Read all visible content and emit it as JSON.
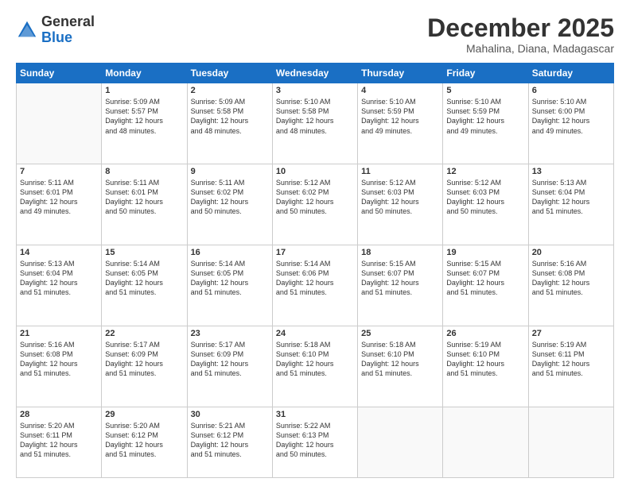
{
  "logo": {
    "general": "General",
    "blue": "Blue"
  },
  "header": {
    "month": "December 2025",
    "location": "Mahalina, Diana, Madagascar"
  },
  "weekdays": [
    "Sunday",
    "Monday",
    "Tuesday",
    "Wednesday",
    "Thursday",
    "Friday",
    "Saturday"
  ],
  "weeks": [
    [
      {
        "day": "",
        "info": ""
      },
      {
        "day": "1",
        "info": "Sunrise: 5:09 AM\nSunset: 5:57 PM\nDaylight: 12 hours\nand 48 minutes."
      },
      {
        "day": "2",
        "info": "Sunrise: 5:09 AM\nSunset: 5:58 PM\nDaylight: 12 hours\nand 48 minutes."
      },
      {
        "day": "3",
        "info": "Sunrise: 5:10 AM\nSunset: 5:58 PM\nDaylight: 12 hours\nand 48 minutes."
      },
      {
        "day": "4",
        "info": "Sunrise: 5:10 AM\nSunset: 5:59 PM\nDaylight: 12 hours\nand 49 minutes."
      },
      {
        "day": "5",
        "info": "Sunrise: 5:10 AM\nSunset: 5:59 PM\nDaylight: 12 hours\nand 49 minutes."
      },
      {
        "day": "6",
        "info": "Sunrise: 5:10 AM\nSunset: 6:00 PM\nDaylight: 12 hours\nand 49 minutes."
      }
    ],
    [
      {
        "day": "7",
        "info": "Sunrise: 5:11 AM\nSunset: 6:01 PM\nDaylight: 12 hours\nand 49 minutes."
      },
      {
        "day": "8",
        "info": "Sunrise: 5:11 AM\nSunset: 6:01 PM\nDaylight: 12 hours\nand 50 minutes."
      },
      {
        "day": "9",
        "info": "Sunrise: 5:11 AM\nSunset: 6:02 PM\nDaylight: 12 hours\nand 50 minutes."
      },
      {
        "day": "10",
        "info": "Sunrise: 5:12 AM\nSunset: 6:02 PM\nDaylight: 12 hours\nand 50 minutes."
      },
      {
        "day": "11",
        "info": "Sunrise: 5:12 AM\nSunset: 6:03 PM\nDaylight: 12 hours\nand 50 minutes."
      },
      {
        "day": "12",
        "info": "Sunrise: 5:12 AM\nSunset: 6:03 PM\nDaylight: 12 hours\nand 50 minutes."
      },
      {
        "day": "13",
        "info": "Sunrise: 5:13 AM\nSunset: 6:04 PM\nDaylight: 12 hours\nand 51 minutes."
      }
    ],
    [
      {
        "day": "14",
        "info": "Sunrise: 5:13 AM\nSunset: 6:04 PM\nDaylight: 12 hours\nand 51 minutes."
      },
      {
        "day": "15",
        "info": "Sunrise: 5:14 AM\nSunset: 6:05 PM\nDaylight: 12 hours\nand 51 minutes."
      },
      {
        "day": "16",
        "info": "Sunrise: 5:14 AM\nSunset: 6:05 PM\nDaylight: 12 hours\nand 51 minutes."
      },
      {
        "day": "17",
        "info": "Sunrise: 5:14 AM\nSunset: 6:06 PM\nDaylight: 12 hours\nand 51 minutes."
      },
      {
        "day": "18",
        "info": "Sunrise: 5:15 AM\nSunset: 6:07 PM\nDaylight: 12 hours\nand 51 minutes."
      },
      {
        "day": "19",
        "info": "Sunrise: 5:15 AM\nSunset: 6:07 PM\nDaylight: 12 hours\nand 51 minutes."
      },
      {
        "day": "20",
        "info": "Sunrise: 5:16 AM\nSunset: 6:08 PM\nDaylight: 12 hours\nand 51 minutes."
      }
    ],
    [
      {
        "day": "21",
        "info": "Sunrise: 5:16 AM\nSunset: 6:08 PM\nDaylight: 12 hours\nand 51 minutes."
      },
      {
        "day": "22",
        "info": "Sunrise: 5:17 AM\nSunset: 6:09 PM\nDaylight: 12 hours\nand 51 minutes."
      },
      {
        "day": "23",
        "info": "Sunrise: 5:17 AM\nSunset: 6:09 PM\nDaylight: 12 hours\nand 51 minutes."
      },
      {
        "day": "24",
        "info": "Sunrise: 5:18 AM\nSunset: 6:10 PM\nDaylight: 12 hours\nand 51 minutes."
      },
      {
        "day": "25",
        "info": "Sunrise: 5:18 AM\nSunset: 6:10 PM\nDaylight: 12 hours\nand 51 minutes."
      },
      {
        "day": "26",
        "info": "Sunrise: 5:19 AM\nSunset: 6:10 PM\nDaylight: 12 hours\nand 51 minutes."
      },
      {
        "day": "27",
        "info": "Sunrise: 5:19 AM\nSunset: 6:11 PM\nDaylight: 12 hours\nand 51 minutes."
      }
    ],
    [
      {
        "day": "28",
        "info": "Sunrise: 5:20 AM\nSunset: 6:11 PM\nDaylight: 12 hours\nand 51 minutes."
      },
      {
        "day": "29",
        "info": "Sunrise: 5:20 AM\nSunset: 6:12 PM\nDaylight: 12 hours\nand 51 minutes."
      },
      {
        "day": "30",
        "info": "Sunrise: 5:21 AM\nSunset: 6:12 PM\nDaylight: 12 hours\nand 51 minutes."
      },
      {
        "day": "31",
        "info": "Sunrise: 5:22 AM\nSunset: 6:13 PM\nDaylight: 12 hours\nand 50 minutes."
      },
      {
        "day": "",
        "info": ""
      },
      {
        "day": "",
        "info": ""
      },
      {
        "day": "",
        "info": ""
      }
    ]
  ]
}
